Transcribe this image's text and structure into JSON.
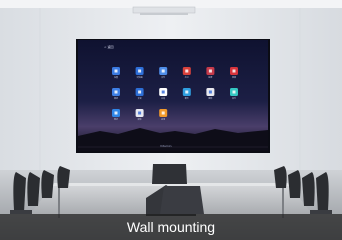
{
  "caption": "Wall mounting",
  "screen": {
    "back_label": "< 返回",
    "brand": "Vitamin",
    "apps": [
      {
        "icon": "settings-app-icon",
        "color": "#3b7ae0",
        "label": "设置"
      },
      {
        "icon": "browser-app-icon",
        "color": "#2e6fd8",
        "label": "浏览器"
      },
      {
        "icon": "files-app-icon",
        "color": "#4f8de8",
        "label": "文件"
      },
      {
        "icon": "office-app-icon",
        "color": "#d9413b",
        "label": "办公"
      },
      {
        "icon": "screen-share-app-icon",
        "color": "#c63a4a",
        "label": "投屏"
      },
      {
        "icon": "video-app-icon",
        "color": "#d8343c",
        "label": "视频"
      },
      {
        "icon": "camera-app-icon",
        "color": "#3e7fe5",
        "label": "相机"
      },
      {
        "icon": "meeting-app-icon",
        "color": "#2d6fd6",
        "label": "会议"
      },
      {
        "icon": "whiteboard-app-icon",
        "color": "#ffffff",
        "label": "白板"
      },
      {
        "icon": "chat-app-icon",
        "color": "#2f9fe0",
        "label": "聊天"
      },
      {
        "icon": "gallery-app-icon",
        "color": "#e8e8ee",
        "label": "图库"
      },
      {
        "icon": "music-app-icon",
        "color": "#35c7c2",
        "label": "音乐"
      },
      {
        "icon": "notes-app-icon",
        "color": "#2f86e8",
        "label": "笔记"
      },
      {
        "icon": "media-app-icon",
        "color": "#e7e9f2",
        "label": "媒体"
      },
      {
        "icon": "store-app-icon",
        "color": "#f19a2b",
        "label": "应用"
      }
    ]
  },
  "colors": {
    "wall": "#e9ebef",
    "screen_bg": "#15172e",
    "table": "#b7b9bd",
    "chair": "#2b2d31",
    "caption_bg": "#1e1e1e"
  }
}
